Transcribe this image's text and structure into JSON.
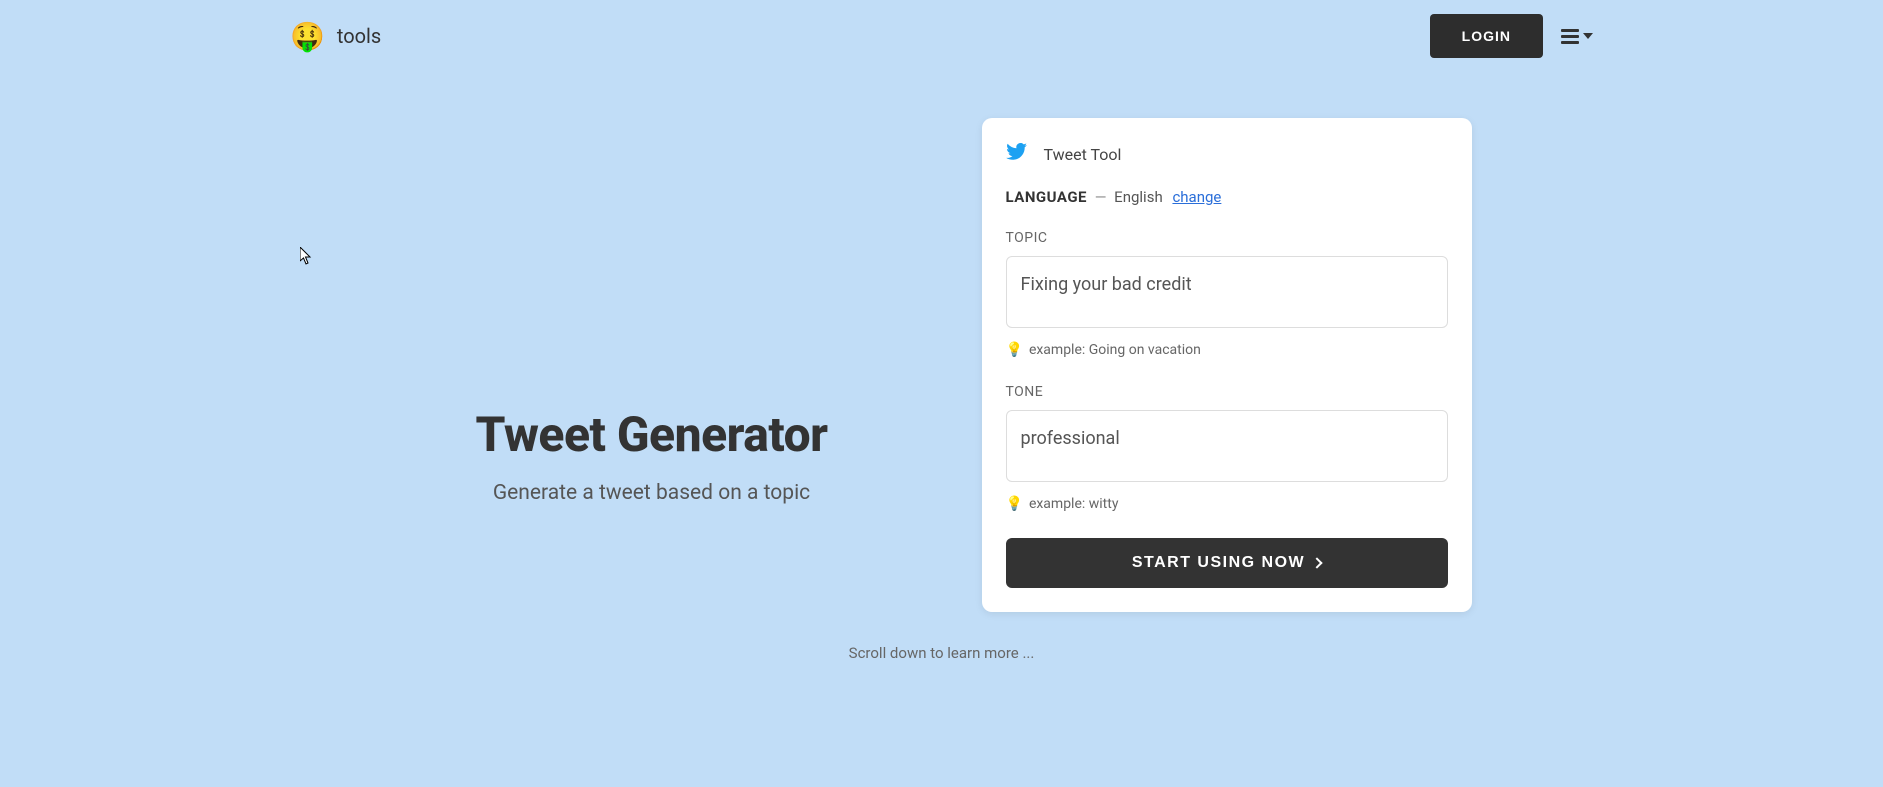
{
  "header": {
    "logo_emoji": "🤑",
    "logo_text": "tools",
    "login_label": "LOGIN"
  },
  "hero": {
    "title": "Tweet Generator",
    "subtitle": "Generate a tweet based on a topic"
  },
  "card": {
    "title": "Tweet Tool",
    "language": {
      "label": "LANGUAGE",
      "dash": "—",
      "value": "English",
      "change_label": "change"
    },
    "topic": {
      "label": "TOPIC",
      "value": "Fixing your bad credit",
      "hint": "example: Going on vacation"
    },
    "tone": {
      "label": "TONE",
      "value": "professional",
      "hint": "example: witty"
    },
    "cta_label": "START USING NOW"
  },
  "scroll_hint": "Scroll down to learn more ...",
  "icons": {
    "bulb": "💡"
  }
}
